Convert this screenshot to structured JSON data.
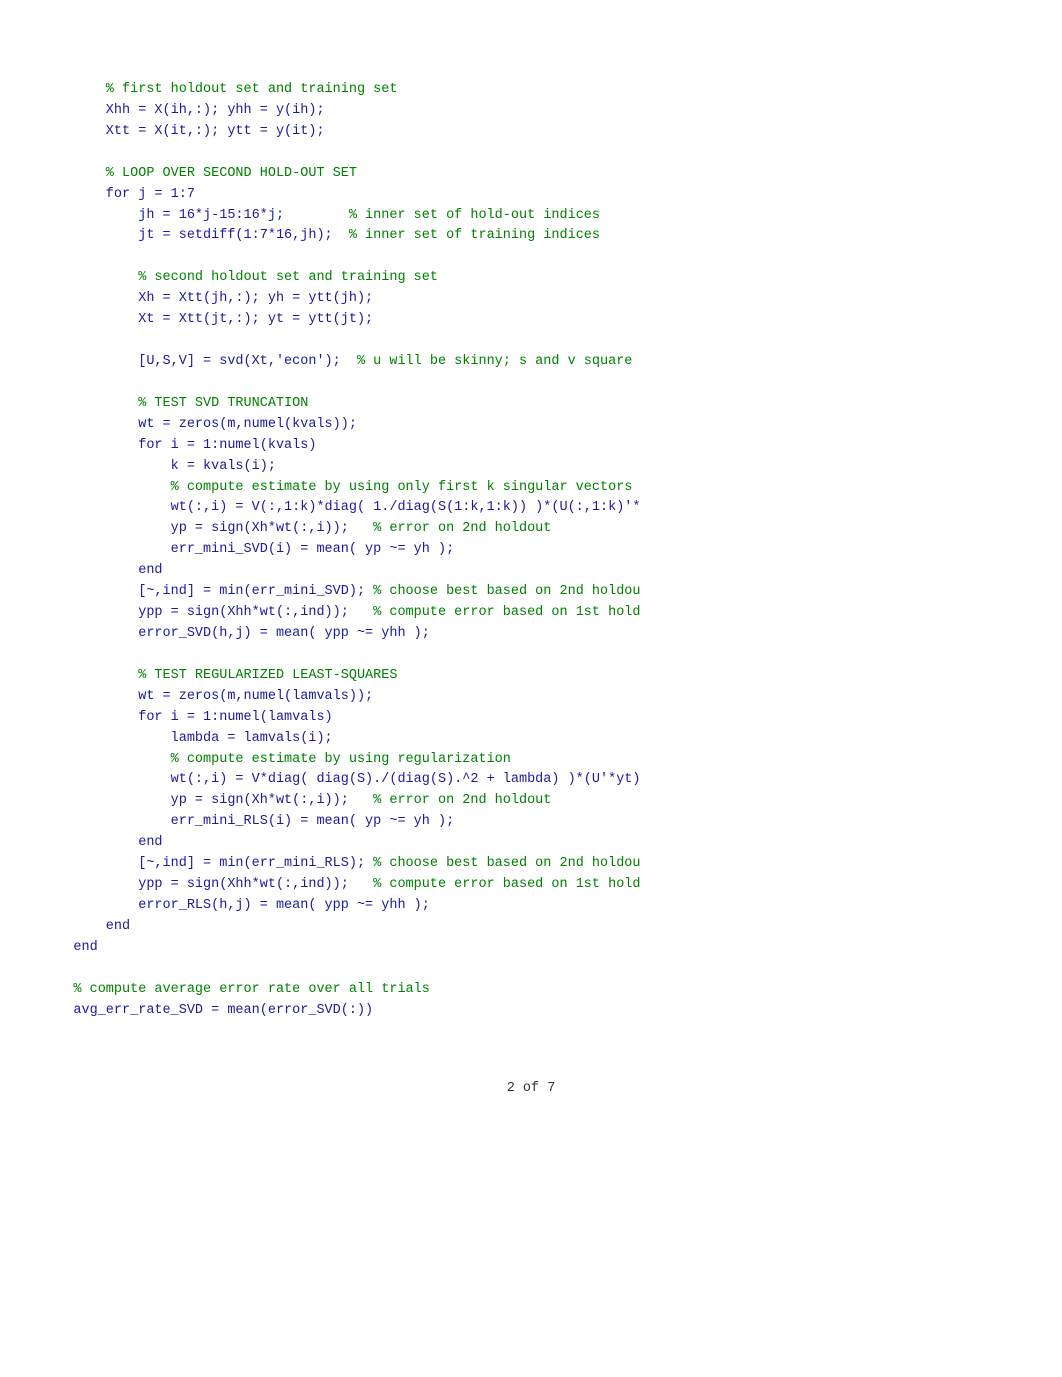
{
  "page": {
    "current": 2,
    "total": 7,
    "footer_label": "2 of 7"
  },
  "code": {
    "lines": [
      {
        "type": "comment",
        "indent": 2,
        "text": "% first holdout set and training set"
      },
      {
        "type": "code",
        "indent": 2,
        "text": "Xhh = X(ih,:); yhh = y(ih);"
      },
      {
        "type": "code",
        "indent": 2,
        "text": "Xtt = X(it,:); ytt = y(it);"
      },
      {
        "type": "blank"
      },
      {
        "type": "comment",
        "indent": 2,
        "text": "% LOOP OVER SECOND HOLD-OUT SET"
      },
      {
        "type": "code",
        "indent": 2,
        "text": "for j = 1:7"
      },
      {
        "type": "code",
        "indent": 3,
        "text": "jh = 16*j-15:16*j;        % inner set of hold-out indices"
      },
      {
        "type": "code",
        "indent": 3,
        "text": "jt = setdiff(1:7*16,jh);  % inner set of training indices"
      },
      {
        "type": "blank"
      },
      {
        "type": "comment",
        "indent": 3,
        "text": "% second holdout set and training set"
      },
      {
        "type": "code",
        "indent": 3,
        "text": "Xh = Xtt(jh,:); yh = ytt(jh);"
      },
      {
        "type": "code",
        "indent": 3,
        "text": "Xt = Xtt(jt,:); yt = ytt(jt);"
      },
      {
        "type": "blank"
      },
      {
        "type": "code",
        "indent": 3,
        "text": "[U,S,V] = svd(Xt,'econ');  % u will be skinny; s and v square"
      },
      {
        "type": "blank"
      },
      {
        "type": "comment",
        "indent": 3,
        "text": "% TEST SVD TRUNCATION"
      },
      {
        "type": "code",
        "indent": 3,
        "text": "wt = zeros(m,numel(kvals));"
      },
      {
        "type": "code",
        "indent": 3,
        "text": "for i = 1:numel(kvals)"
      },
      {
        "type": "code",
        "indent": 4,
        "text": "k = kvals(i);"
      },
      {
        "type": "comment",
        "indent": 4,
        "text": "% compute estimate by using only first k singular vectors"
      },
      {
        "type": "code",
        "indent": 4,
        "text": "wt(:,i) = V(:,1:k)*diag( 1./diag(S(1:k,1:k)) )*(U(:,1:k)'*"
      },
      {
        "type": "code",
        "indent": 4,
        "text": "yp = sign(Xh*wt(:,i));   % error on 2nd holdout"
      },
      {
        "type": "code",
        "indent": 4,
        "text": "err_mini_SVD(i) = mean( yp ~= yh );"
      },
      {
        "type": "code",
        "indent": 3,
        "text": "end"
      },
      {
        "type": "code",
        "indent": 3,
        "text": "[~,ind] = min(err_mini_SVD); % choose best based on 2nd holdou"
      },
      {
        "type": "code",
        "indent": 3,
        "text": "ypp = sign(Xhh*wt(:,ind));   % compute error based on 1st hold"
      },
      {
        "type": "code",
        "indent": 3,
        "text": "error_SVD(h,j) = mean( ypp ~= yhh );"
      },
      {
        "type": "blank"
      },
      {
        "type": "comment",
        "indent": 3,
        "text": "% TEST REGULARIZED LEAST-SQUARES"
      },
      {
        "type": "code",
        "indent": 3,
        "text": "wt = zeros(m,numel(lamvals));"
      },
      {
        "type": "code",
        "indent": 3,
        "text": "for i = 1:numel(lamvals)"
      },
      {
        "type": "code",
        "indent": 4,
        "text": "lambda = lamvals(i);"
      },
      {
        "type": "comment",
        "indent": 4,
        "text": "% compute estimate by using regularization"
      },
      {
        "type": "code",
        "indent": 4,
        "text": "wt(:,i) = V*diag( diag(S)./(diag(S).^2 + lambda) )*(U'*yt)"
      },
      {
        "type": "code",
        "indent": 4,
        "text": "yp = sign(Xh*wt(:,i));   % error on 2nd holdout"
      },
      {
        "type": "code",
        "indent": 4,
        "text": "err_mini_RLS(i) = mean( yp ~= yh );"
      },
      {
        "type": "code",
        "indent": 3,
        "text": "end"
      },
      {
        "type": "code",
        "indent": 3,
        "text": "[~,ind] = min(err_mini_RLS); % choose best based on 2nd holdou"
      },
      {
        "type": "code",
        "indent": 3,
        "text": "ypp = sign(Xhh*wt(:,ind));   % compute error based on 1st hold"
      },
      {
        "type": "code",
        "indent": 3,
        "text": "error_RLS(h,j) = mean( ypp ~= yhh );"
      },
      {
        "type": "code",
        "indent": 2,
        "text": "end"
      },
      {
        "type": "code",
        "indent": 1,
        "text": "end"
      },
      {
        "type": "blank"
      },
      {
        "type": "comment",
        "indent": 1,
        "text": "% compute average error rate over all trials"
      },
      {
        "type": "code",
        "indent": 1,
        "text": "avg_err_rate_SVD = mean(error_SVD(:))"
      }
    ]
  }
}
